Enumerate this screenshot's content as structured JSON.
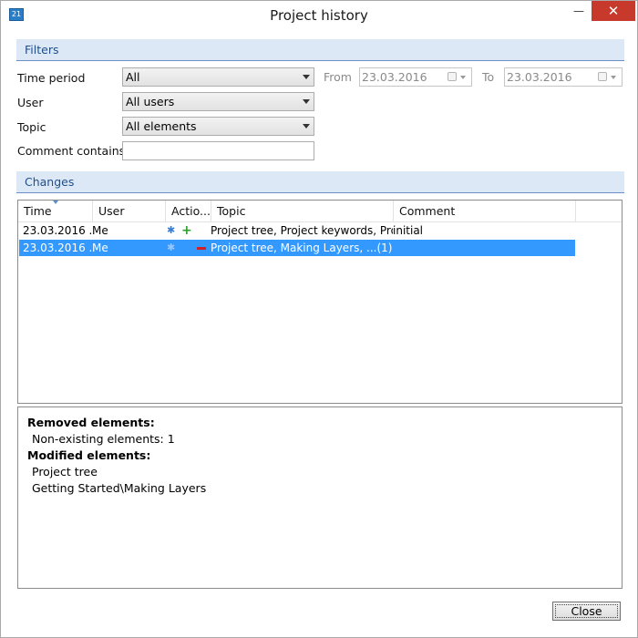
{
  "window": {
    "title": "Project history",
    "icon": "app-icon"
  },
  "filters": {
    "header": "Filters",
    "time_period": {
      "label": "Time period",
      "value": "All"
    },
    "from": {
      "label": "From",
      "value": "23.03.2016"
    },
    "to": {
      "label": "To",
      "value": "23.03.2016"
    },
    "user": {
      "label": "User",
      "value": "All users"
    },
    "topic": {
      "label": "Topic",
      "value": "All elements"
    },
    "comment": {
      "label": "Comment contains",
      "value": ""
    }
  },
  "changes": {
    "header": "Changes",
    "columns": [
      "Time",
      "User",
      "Actio...",
      "Topic",
      "Comment"
    ],
    "rows": [
      {
        "time": "23.03.2016 ...",
        "user": "Me",
        "actions": [
          "modified-icon",
          "added-icon"
        ],
        "topic": "Project tree, Project keywords, Proj...",
        "comment": "initial",
        "selected": false
      },
      {
        "time": "23.03.2016 ...",
        "user": "Me",
        "actions": [
          "modified-icon",
          "removed-icon"
        ],
        "topic": "Project tree, Making Layers, ...(1)",
        "comment": "",
        "selected": true
      }
    ]
  },
  "details": {
    "removed_header": "Removed elements:",
    "removed_items": [
      "Non-existing elements: 1"
    ],
    "modified_header": "Modified elements:",
    "modified_items": [
      "Project tree",
      "Getting Started\\Making Layers"
    ]
  },
  "buttons": {
    "close": "Close"
  },
  "colors": {
    "selection": "#3399ff",
    "section_header": "#dce8f6",
    "close_hover": "#c7392b"
  }
}
